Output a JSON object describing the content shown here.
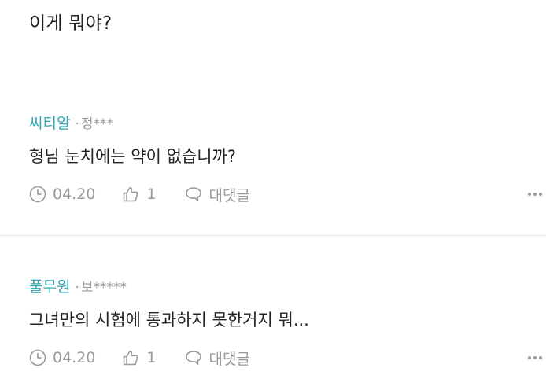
{
  "header": {
    "text": "이게 뭐야?"
  },
  "comments": [
    {
      "nickname": "씨티알",
      "separator": "·",
      "user_id": "정***",
      "body": "형님 눈치에는 약이 없습니까?",
      "date": "04.20",
      "like_count": "1",
      "reply_label": "대댓글",
      "icons": {
        "clock": "clock-icon",
        "thumb": "thumbs-up-icon",
        "reply": "speech-bubble-icon",
        "more": "more-options-icon"
      }
    },
    {
      "nickname": "풀무원",
      "separator": "·",
      "user_id": "보*****",
      "body": "그녀만의 시험에 통과하지 못한거지 뭐...",
      "date": "04.20",
      "like_count": "1",
      "reply_label": "대댓글",
      "icons": {
        "clock": "clock-icon",
        "thumb": "thumbs-up-icon",
        "reply": "speech-bubble-icon",
        "more": "more-options-icon"
      }
    }
  ],
  "colors": {
    "nickname": "#35a9b6",
    "text": "#222222",
    "muted": "#999999",
    "divider": "#e8e8e8"
  }
}
